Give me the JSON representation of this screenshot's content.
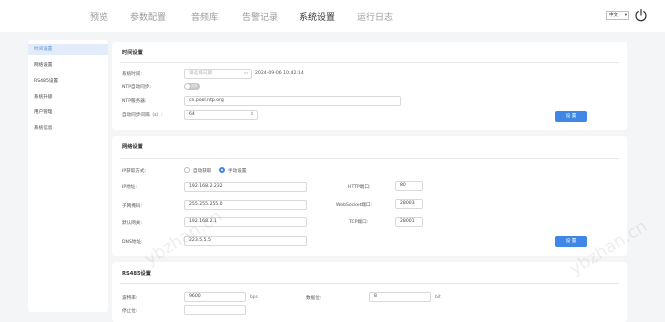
{
  "nav": {
    "items": [
      "预览",
      "参数配置",
      "音频库",
      "告警记录",
      "系统设置",
      "运行日志"
    ],
    "active": "系统设置",
    "language": "中文"
  },
  "sidebar": {
    "items": [
      "时间设置",
      "网络设置",
      "RS485设置",
      "系统升级",
      "用户管理",
      "系统信息"
    ],
    "active": "时间设置"
  },
  "time_panel": {
    "title": "时间设置",
    "system_time_label": "系统时间:",
    "date_placeholder": "请选择日期",
    "system_time_value": "2024-09-06 10:42:14",
    "ntp_auto_label": "NTP自动同步:",
    "ntp_toggle_text": "关闭",
    "ntp_server_label": "NTP服务器:",
    "ntp_server_value": "cn.pool.ntp.org",
    "interval_label": "自动同步间隔（s）:",
    "interval_value": "64",
    "save_button": "设 置"
  },
  "network_panel": {
    "title": "网络设置",
    "ip_mode_label": "IP获取方式:",
    "auto_option": "自动获取",
    "manual_option": "手动设置",
    "selected_mode": "手动设置",
    "ip_label": "IP地址:",
    "ip_value": "192.168.2.232",
    "mask_label": "子网掩码:",
    "mask_value": "255.255.255.0",
    "gateway_label": "默认网关:",
    "gateway_value": "192.168.2.1",
    "dns_label": "DNS地址:",
    "dns_value": "223.5.5.5",
    "http_port_label": "HTTP端口:",
    "http_port_value": "80",
    "websocket_port_label": "WebSocket端口:",
    "websocket_port_value": "28003",
    "tcp_port_label": "TCP端口:",
    "tcp_port_value": "28001",
    "save_button": "设 置"
  },
  "rs485_panel": {
    "title": "RS485设置",
    "baud_label": "波特率:",
    "baud_value": "9600",
    "baud_unit": "bps",
    "data_bits_label": "数据位:",
    "data_bits_value": "8",
    "data_bits_unit": "bit",
    "next_label": "停止位:"
  },
  "watermark": "ybzhan.cn"
}
